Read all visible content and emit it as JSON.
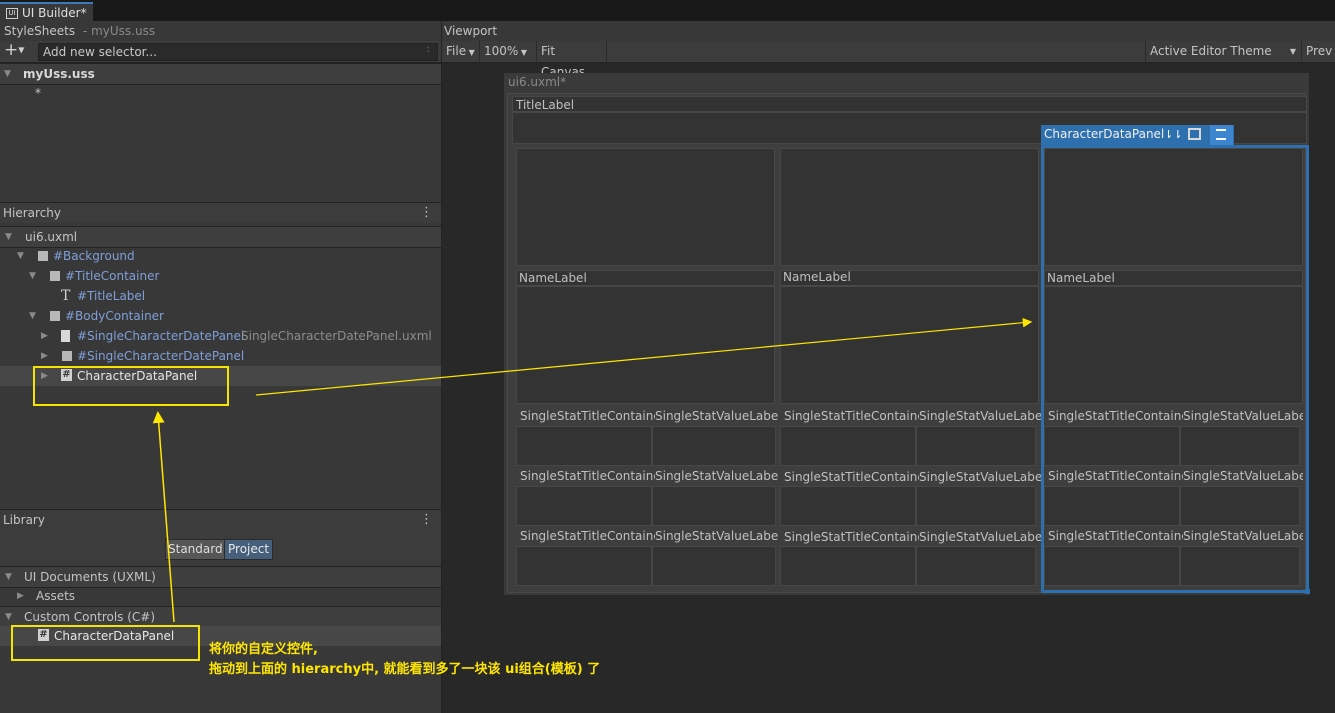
{
  "tab": {
    "title": "UI Builder*"
  },
  "stylesheets": {
    "title": "StyleSheets",
    "file": "- myUss.uss",
    "add_placeholder": "Add new selector...",
    "uss_name": "myUss.uss",
    "selector": "*"
  },
  "hierarchy": {
    "title": "Hierarchy",
    "root": "ui6.uxml",
    "items": [
      "#Background",
      "#TitleContainer",
      "#TitleLabel",
      "#BodyContainer",
      "#SingleCharacterDatePanel",
      "#SingleCharacterDatePanel",
      "CharacterDataPanel"
    ],
    "template_file": "SingleCharacterDatePanel.uxml"
  },
  "library": {
    "title": "Library",
    "tab_standard": "Standard",
    "tab_project": "Project",
    "uxml_section": "UI Documents (UXML)",
    "assets": "Assets",
    "custom_section": "Custom Controls (C#)",
    "custom_item": "CharacterDataPanel"
  },
  "viewport": {
    "title": "Viewport",
    "file_menu": "File",
    "zoom": "100%",
    "fit_canvas": "Fit Canvas",
    "theme": "Active Editor Theme",
    "preview": "Prev",
    "doc_name": "ui6.uxml*",
    "title_label": "TitleLabel",
    "selected_label": "CharacterDataPanel",
    "name_label": "NameLabel",
    "stat_title": "SingleStatTitleContainer",
    "stat_value": "SingleStatValueLabel"
  },
  "annotation": {
    "line1": "将你的自定义控件,",
    "line2": "拖动到上面的 hierarchy中, 就能看到多了一块该 ui组合(模板) 了"
  },
  "colors": {
    "accent": "#3a79bb",
    "annotation": "#ffe600",
    "link_blue": "#7f9fd8"
  }
}
